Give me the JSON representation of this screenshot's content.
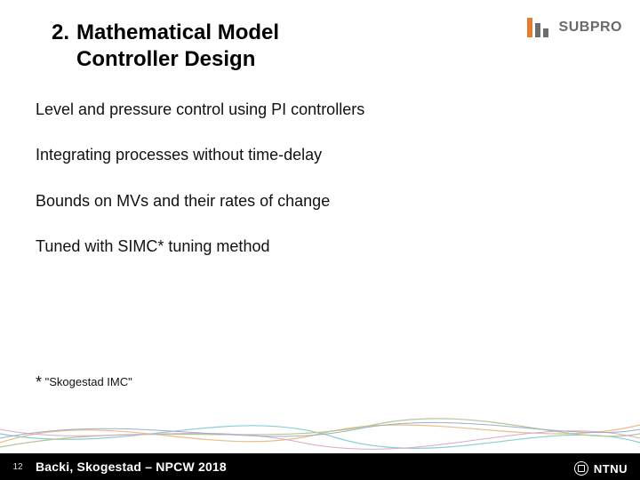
{
  "brand": {
    "subpro": "SUBPRO"
  },
  "title": {
    "number": "2.",
    "line1": "Mathematical Model",
    "line2": "Controller Design"
  },
  "bullets": [
    "Level and pressure control using PI controllers",
    "Integrating processes without time-delay",
    "Bounds on MVs and their rates of change",
    "Tuned with SIMC* tuning method"
  ],
  "footnote": {
    "mark": "*",
    "text": "\"Skogestad IMC\""
  },
  "footer": {
    "page": "12",
    "text": "Backi, Skogestad – NPCW 2018",
    "ntnu": "NTNU"
  }
}
